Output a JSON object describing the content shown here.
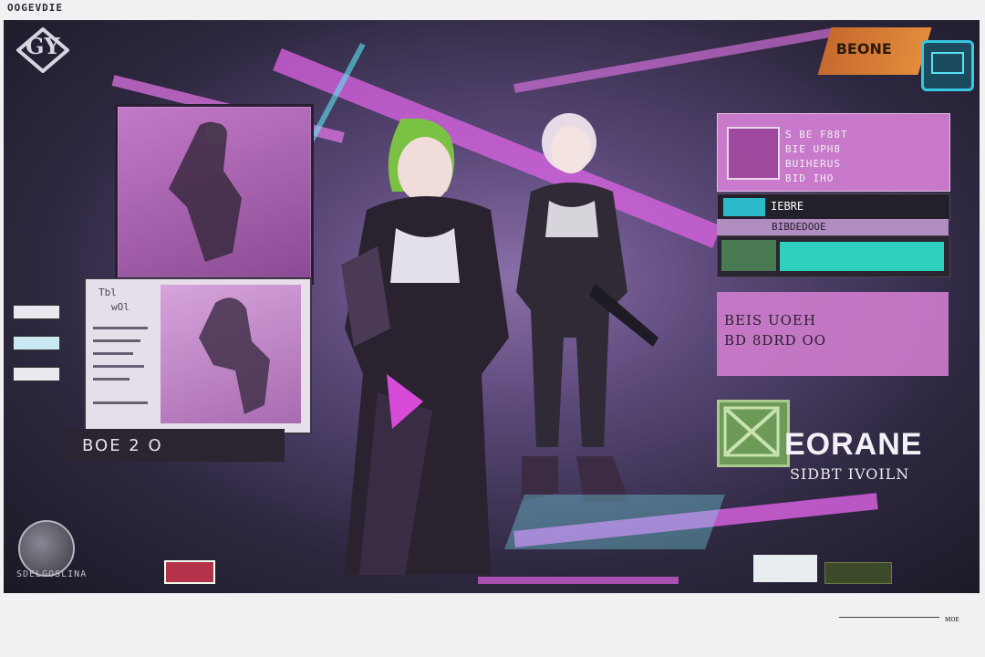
{
  "page": {
    "top_caption": "OOGEVDIE",
    "bottom_caption": "ᴍᴏᴇ"
  },
  "hud": {
    "emblem_text": "GY",
    "banner_text": "BEONE",
    "code_label": "BOE 2 O",
    "footer_caption": "SDELGOSLINA",
    "monitor_text_1": "Tbl",
    "monitor_text_2": "wOl"
  },
  "character_card": {
    "line1": "S BE F88T",
    "line2": "BIE UPH8",
    "line3": "BUIHERUS",
    "line4": "BID  IHO",
    "row_dark_text": "IEBRE",
    "row_light_text": "BIBDEDOOE"
  },
  "description": {
    "line1": "BEIS  UOEH",
    "line2": "BD  8DRD OO"
  },
  "title": {
    "game_title": "EORANE",
    "subtitle": "SIDBT IVOILN"
  },
  "colors": {
    "accent_magenta": "#d47fd4",
    "accent_teal": "#2fd0be",
    "accent_green": "#6d9a58",
    "background_dark": "#1b1824"
  },
  "icons": [
    "emblem-icon",
    "tv-icon",
    "globe-icon",
    "logo-x-icon"
  ]
}
